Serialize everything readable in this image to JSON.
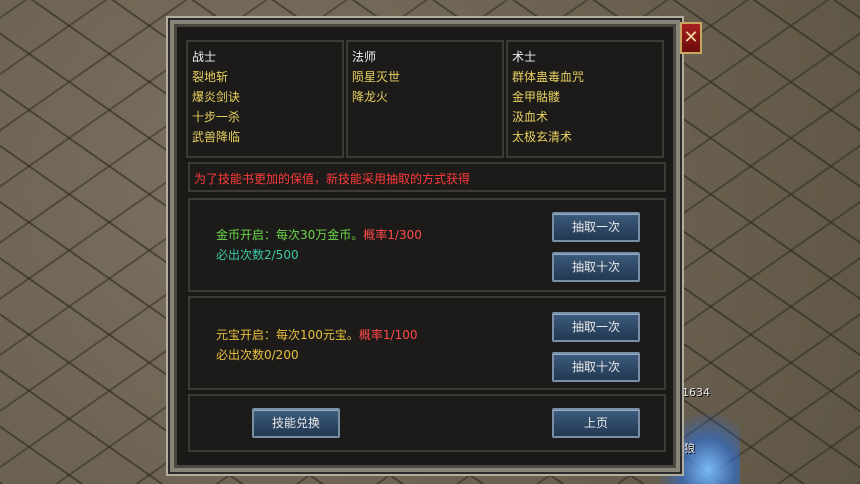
{
  "scene": {
    "labels": [
      "1634",
      "狼"
    ]
  },
  "window": {
    "close_glyph": "✕",
    "columns": [
      {
        "title": "战士",
        "skills": [
          "裂地斩",
          "爆炎剑诀",
          "十步一杀",
          "武兽降临"
        ]
      },
      {
        "title": "法师",
        "skills": [
          "陨星灭世",
          "降龙火"
        ]
      },
      {
        "title": "术士",
        "skills": [
          "群体蛊毒血咒",
          "金甲骷髅",
          "汲血术",
          "太极玄清术"
        ]
      }
    ],
    "notice": "为了技能书更加的保值，新技能采用抽取的方式获得",
    "gold": {
      "prefix": "金币开启：每次30万金币。",
      "rate": "概率1/300",
      "guarantee": "必出次数2/500",
      "btn_once": "抽取一次",
      "btn_ten": "抽取十次"
    },
    "ingot": {
      "prefix": "元宝开启：每次100元宝。",
      "rate": "概率1/100",
      "guarantee": "必出次数0/200",
      "btn_once": "抽取一次",
      "btn_ten": "抽取十次"
    },
    "exchange_button": "技能兑换",
    "prev_page_button": "上页"
  },
  "colors": {
    "skill_name": "#e8d060",
    "notice": "#ff3a3a",
    "gold_text": "#6cd64a",
    "gold_guarantee": "#3cc8a8",
    "ingot_text": "#e8c040",
    "rate": "#ff4a4a"
  }
}
